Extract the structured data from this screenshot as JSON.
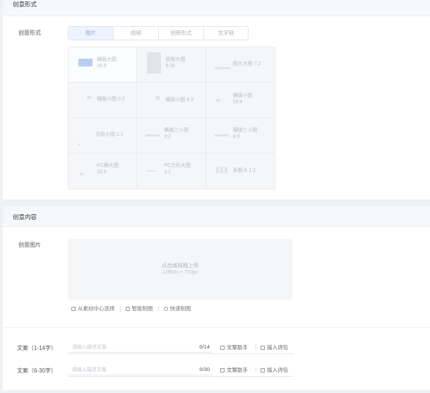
{
  "section1": {
    "title": "创意形式",
    "field_label": "创意形式",
    "tabs": [
      {
        "label": "图片",
        "active": true
      },
      {
        "label": "视频",
        "active": false
      },
      {
        "label": "创新形式",
        "active": false
      },
      {
        "label": "文字链",
        "active": false
      }
    ],
    "formats": [
      {
        "name": "横版大图",
        "ratio": "16:9"
      },
      {
        "name": "竖版大图",
        "ratio": "9:16"
      },
      {
        "name": "图片大图 7:2",
        "ratio": ""
      },
      {
        "name": "横版小图 3:2",
        "ratio": ""
      },
      {
        "name": "横版小图 4:3",
        "ratio": ""
      },
      {
        "name": "横版小图",
        "ratio": "16:9"
      },
      {
        "name": "方形小图 1:1",
        "ratio": ""
      },
      {
        "name": "横版三小图",
        "ratio": "3:2"
      },
      {
        "name": "横版三小图",
        "ratio": "4:3"
      },
      {
        "name": "PC横大图",
        "ratio": "16:9"
      },
      {
        "name": "PC方形大图",
        "ratio": "1:1"
      },
      {
        "name": "多图卡 1:1",
        "ratio": ""
      }
    ]
  },
  "section2": {
    "title": "创意内容",
    "image_label": "创意图片",
    "upload_main": "点击或拖拽上传",
    "upload_sub": "1280px × 720px",
    "tools": [
      {
        "label": "从素材中心选择",
        "icon": "image-icon"
      },
      {
        "label": "智能制图",
        "icon": "magic-icon"
      },
      {
        "label": "快速制图",
        "icon": "quick-icon"
      }
    ],
    "text_rows": [
      {
        "label": "文案（1-14字）",
        "placeholder": "请输入描述文案",
        "counter": "0/14",
        "assistant": "文案助手",
        "insert": "插入词包"
      },
      {
        "label": "文案（6-30字）",
        "placeholder": "请输入描述文案",
        "counter": "0/30",
        "assistant": "文案助手",
        "insert": "插入词包"
      }
    ]
  },
  "colors": {
    "active_tab_bg": "#eef4ff",
    "selected_thumb": "#b8cdf2"
  }
}
